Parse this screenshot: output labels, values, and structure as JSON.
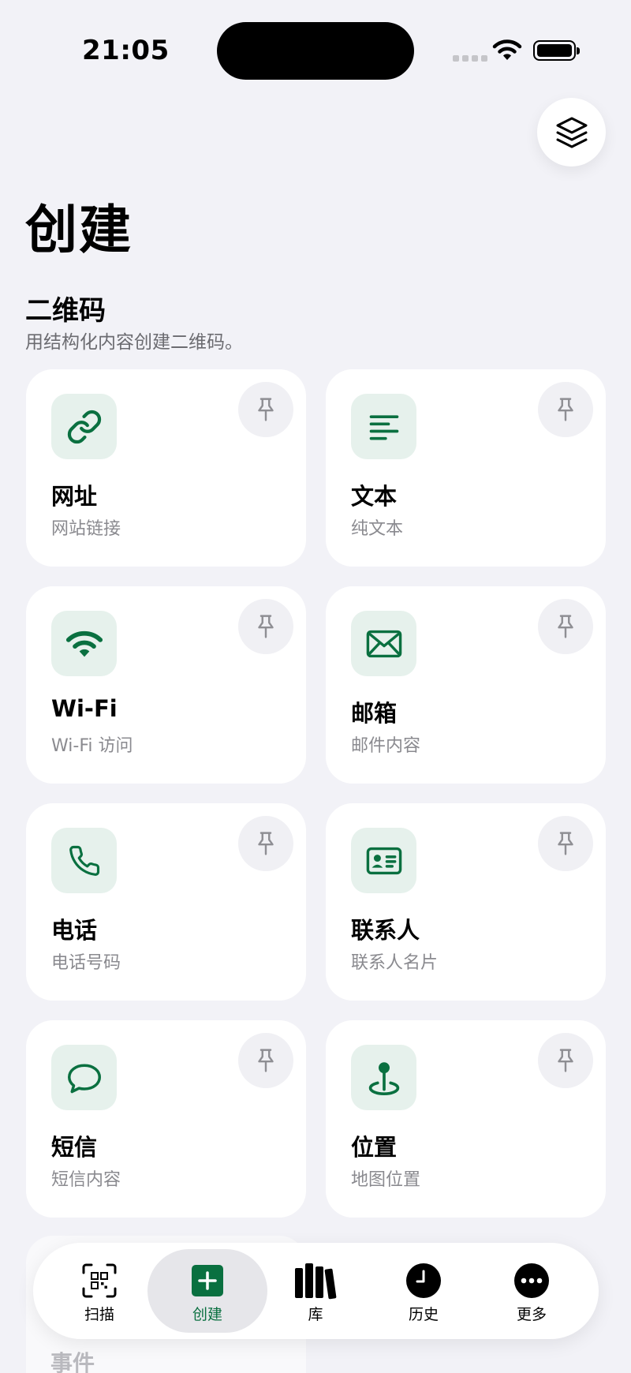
{
  "status_bar": {
    "time": "21:05"
  },
  "page": {
    "title": "创建"
  },
  "section": {
    "title": "二维码",
    "subtitle": "用结构化内容创建二维码。"
  },
  "colors": {
    "accent": "#0A7040",
    "tile_bg": "#E6F1EC",
    "background": "#F2F2F7"
  },
  "cards": [
    {
      "title": "网址",
      "subtitle": "网站链接",
      "icon": "link-icon"
    },
    {
      "title": "文本",
      "subtitle": "纯文本",
      "icon": "text-lines-icon"
    },
    {
      "title": "Wi-Fi",
      "subtitle": "Wi-Fi 访问",
      "icon": "wifi-icon"
    },
    {
      "title": "邮箱",
      "subtitle": "邮件内容",
      "icon": "envelope-icon"
    },
    {
      "title": "电话",
      "subtitle": "电话号码",
      "icon": "phone-icon"
    },
    {
      "title": "联系人",
      "subtitle": "联系人名片",
      "icon": "contact-card-icon"
    },
    {
      "title": "短信",
      "subtitle": "短信内容",
      "icon": "message-bubble-icon"
    },
    {
      "title": "位置",
      "subtitle": "地图位置",
      "icon": "location-pin-icon"
    },
    {
      "title": "事件",
      "subtitle": "",
      "icon": "calendar-icon"
    }
  ],
  "tabs": [
    {
      "label": "扫描",
      "icon": "qr-scan-icon",
      "active": false
    },
    {
      "label": "创建",
      "icon": "plus-square-icon",
      "active": true
    },
    {
      "label": "库",
      "icon": "books-icon",
      "active": false
    },
    {
      "label": "历史",
      "icon": "clock-icon",
      "active": false
    },
    {
      "label": "更多",
      "icon": "ellipsis-icon",
      "active": false
    }
  ]
}
